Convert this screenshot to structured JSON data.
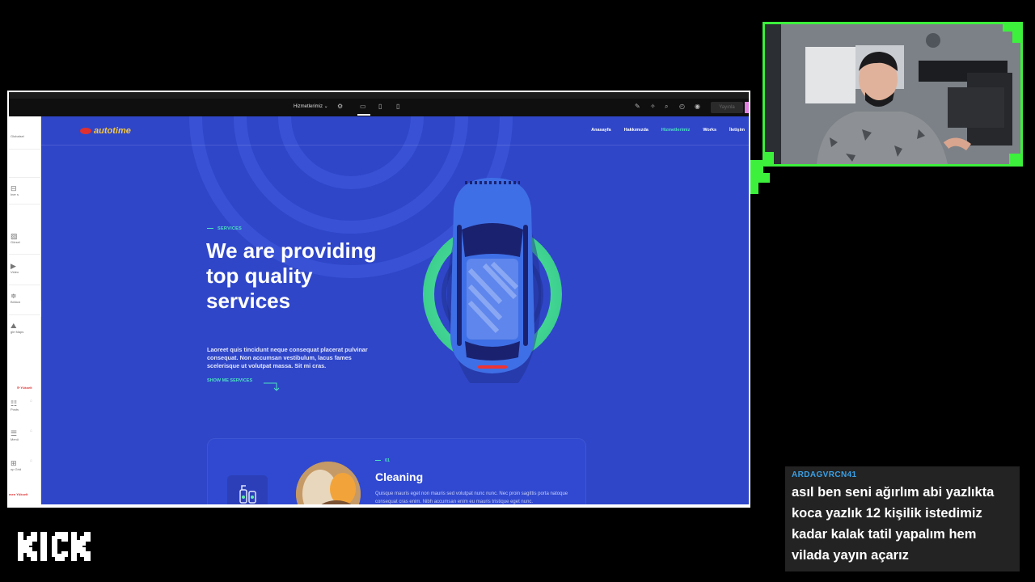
{
  "bookmarks": [
    "",
    "",
    "",
    "",
    "",
    "",
    "",
    "",
    "",
    "",
    "",
    "",
    "",
    ""
  ],
  "editor": {
    "page_name": "Hizmetlerimiz",
    "publish_label": "Yayınla",
    "sidebar": {
      "globalsel": "Globalsel",
      "inner": "Iner s",
      "image": "Görsel",
      "video": "Video",
      "divider": "Bölücü",
      "maps": "gle Maps",
      "pro_label": "Yükselt",
      "posts": "Posts",
      "menu": "Menü",
      "loop": "op Grid",
      "pro_bottom": "men Yükselt"
    }
  },
  "site": {
    "logo_text": "autotime",
    "nav": [
      "Anasayfa",
      "Hakkımızda",
      "Hizmetlerimiz",
      "Works",
      "İletişim"
    ],
    "active_nav": 2,
    "kicker": "SERVICES",
    "title": "We are providing top quality services",
    "description": "Laoreet quis tincidunt neque consequat placerat pulvinar consequat. Non accumsan vestibulum, lacus fames scelerisque ut volutpat massa. Sit mi cras.",
    "cta": "SHOW ME SERVICES",
    "card": {
      "number": "01",
      "title": "Cleaning",
      "text": "Quisque mauris eget non mauris sed volutpat nunc nunc. Nec proin sagittis porta natoque consequat cras enim. Nibh accumsan enim eu mauris tristique eget nunc."
    },
    "colors": {
      "bg": "#2f46c9",
      "accent": "#4de3c0",
      "car": "#3f6fe6",
      "ring": "#5ef0a8"
    }
  },
  "chat": {
    "username": "ARDAGVRCN41",
    "message": "asıl ben seni ağırlım abi yazlıkta koca yazlık 12 kişilik istedimiz kadar kalak tatil yapalım hem vilada yayın açarız"
  },
  "brand": "KICK"
}
